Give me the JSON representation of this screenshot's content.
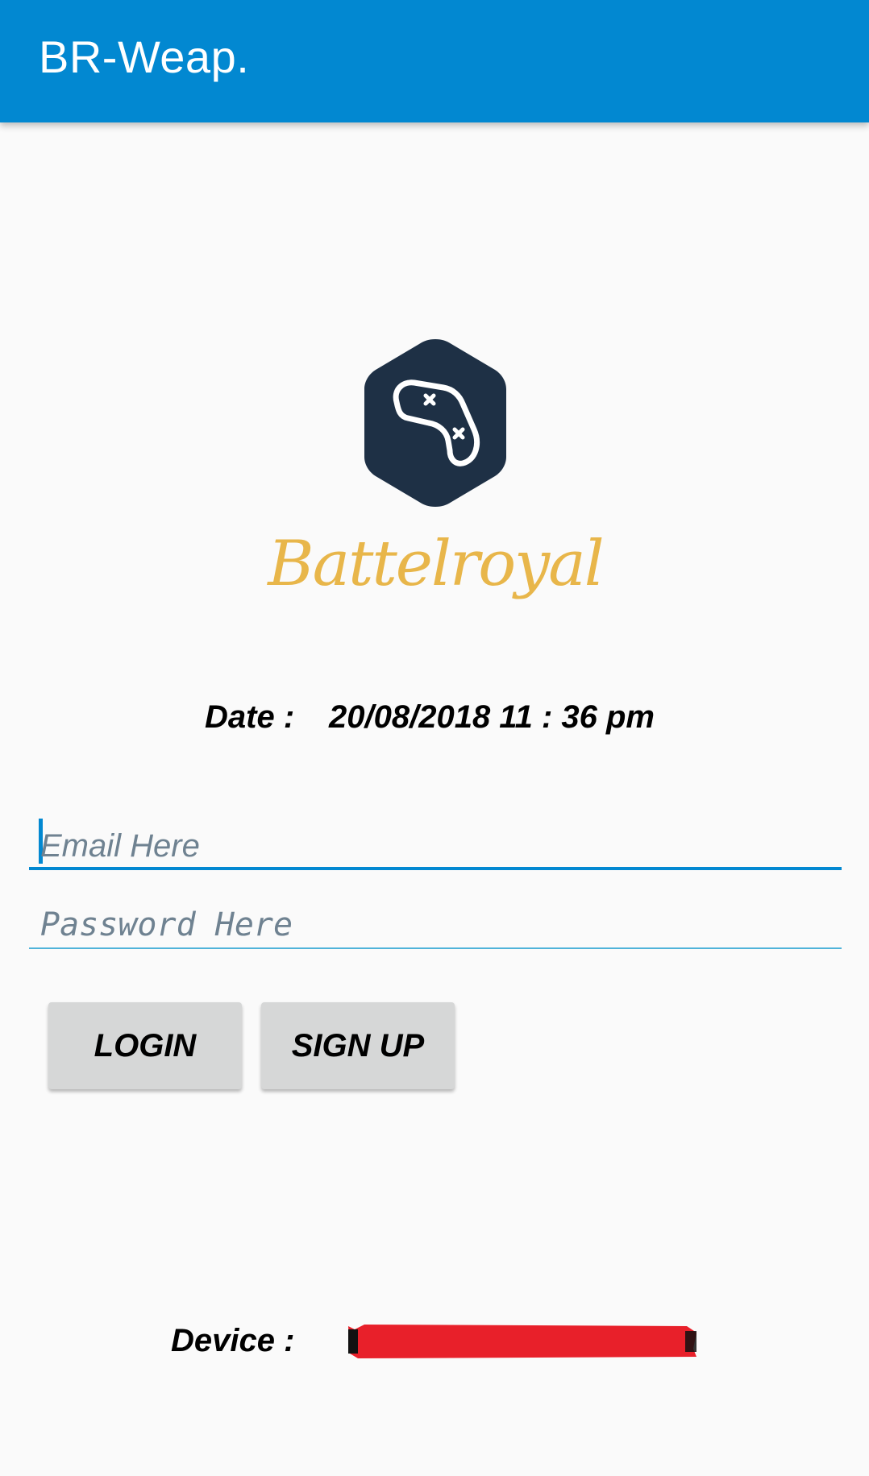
{
  "app_bar": {
    "title": "BR-Weap."
  },
  "logo": {
    "icon": "gamepad-hexagon-icon",
    "text": "Battelroyal",
    "hex_color": "#1e3045",
    "text_color": "#e8b64a"
  },
  "date": {
    "label": "Date :",
    "value": "20/08/2018 11 : 36 pm"
  },
  "form": {
    "email_placeholder": "Email Here",
    "email_value": "",
    "password_placeholder": "Password Here",
    "password_value": ""
  },
  "buttons": {
    "login_label": "LOGIN",
    "signup_label": "SIGN UP"
  },
  "device": {
    "label": "Device  :"
  },
  "colors": {
    "primary": "#0288d1",
    "background": "#fafafa",
    "button_bg": "#d6d7d7",
    "redaction": "#e8202a"
  }
}
